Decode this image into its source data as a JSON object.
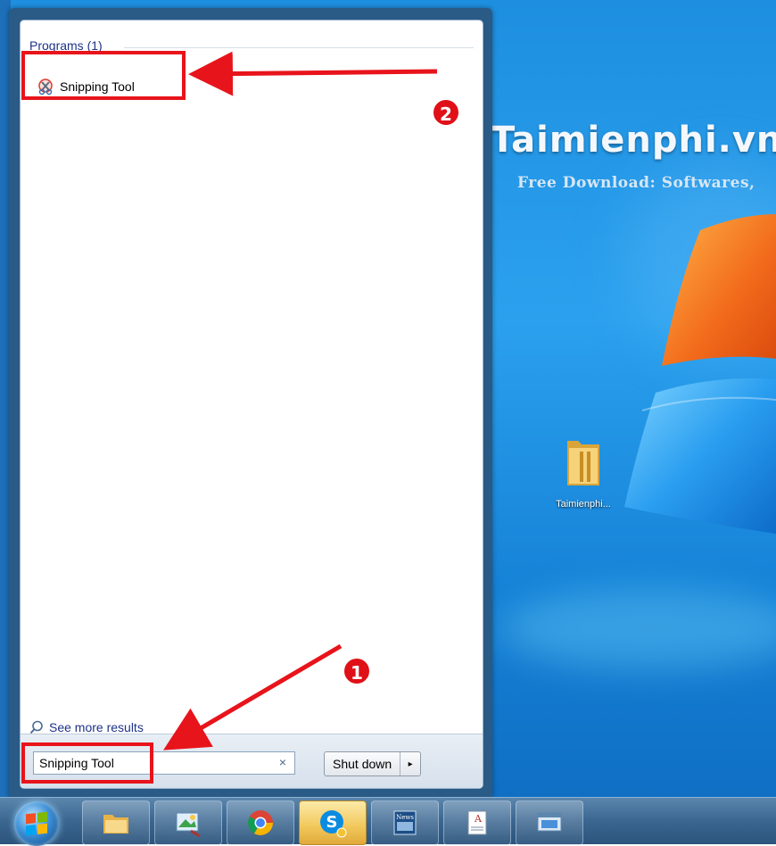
{
  "desktop": {
    "watermark_title": "Taimienphi.vn",
    "watermark_subtitle": "Free Download: Softwares,",
    "icons": [
      {
        "label": "Taimienphi..."
      }
    ]
  },
  "start_menu": {
    "programs_header": "Programs (1)",
    "results": [
      {
        "label": "Snipping Tool"
      }
    ],
    "see_more": "See more results",
    "search": {
      "value": "Snipping Tool",
      "clear_glyph": "×"
    },
    "shutdown_label": "Shut down",
    "shutdown_arrow": "▸"
  },
  "taskbar": {
    "start_button": "start-orb",
    "items": [
      {
        "icon": "file-explorer-icon"
      },
      {
        "icon": "photo-viewer-icon"
      },
      {
        "icon": "chrome-icon"
      },
      {
        "icon": "skype-icon",
        "active": true
      },
      {
        "icon": "news-icon",
        "caption": "News"
      },
      {
        "icon": "document-icon"
      },
      {
        "icon": "window-icon"
      }
    ]
  },
  "annotations": {
    "step1": "1",
    "step2": "2",
    "color": "#e8141b"
  }
}
